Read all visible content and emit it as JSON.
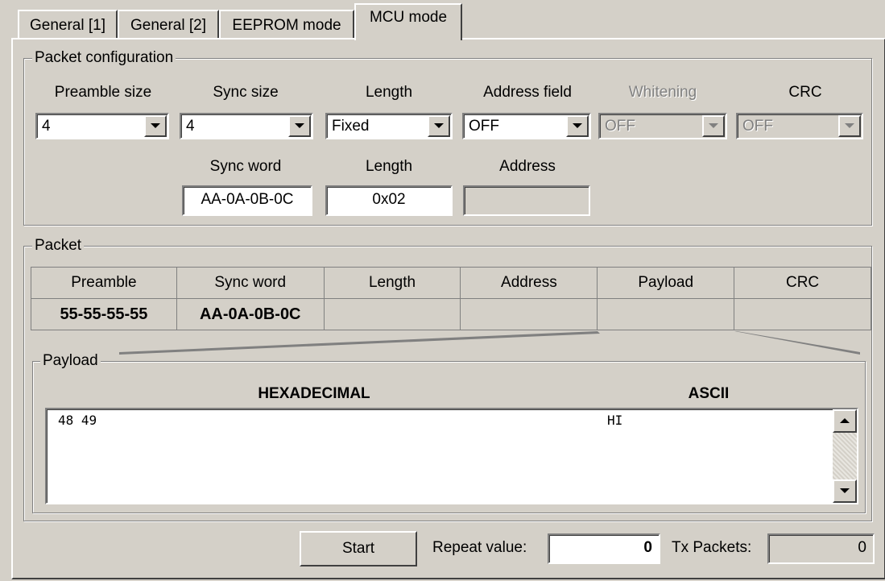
{
  "tabs": [
    {
      "label": "General [1]"
    },
    {
      "label": "General [2]"
    },
    {
      "label": "EEPROM mode"
    },
    {
      "label": "MCU mode"
    }
  ],
  "packet_config": {
    "title": "Packet configuration",
    "preamble_size": {
      "label": "Preamble size",
      "value": "4"
    },
    "sync_size": {
      "label": "Sync size",
      "value": "4"
    },
    "length": {
      "label": "Length",
      "value": "Fixed"
    },
    "address_field": {
      "label": "Address field",
      "value": "OFF"
    },
    "whitening": {
      "label": "Whitening",
      "value": "OFF"
    },
    "crc": {
      "label": "CRC",
      "value": "OFF"
    },
    "sync_word": {
      "label": "Sync word",
      "value": "AA-0A-0B-0C"
    },
    "length_value": {
      "label": "Length",
      "value": "0x02"
    },
    "address": {
      "label": "Address",
      "value": ""
    }
  },
  "packet": {
    "title": "Packet",
    "headers": [
      "Preamble",
      "Sync word",
      "Length",
      "Address",
      "Payload",
      "CRC"
    ],
    "values": [
      "55-55-55-55",
      "AA-0A-0B-0C",
      "",
      "",
      "",
      ""
    ]
  },
  "payload": {
    "title": "Payload",
    "hex_header": "HEXADECIMAL",
    "ascii_header": "ASCII",
    "hex_text": "48 49",
    "ascii_text": "HI"
  },
  "footer": {
    "start_label": "Start",
    "repeat_label": "Repeat value:",
    "repeat_value": "0",
    "tx_label": "Tx Packets:",
    "tx_value": "0"
  },
  "colors": {
    "face": "#d4d0c8",
    "shadow": "#808080",
    "highlight": "#ffffff"
  }
}
